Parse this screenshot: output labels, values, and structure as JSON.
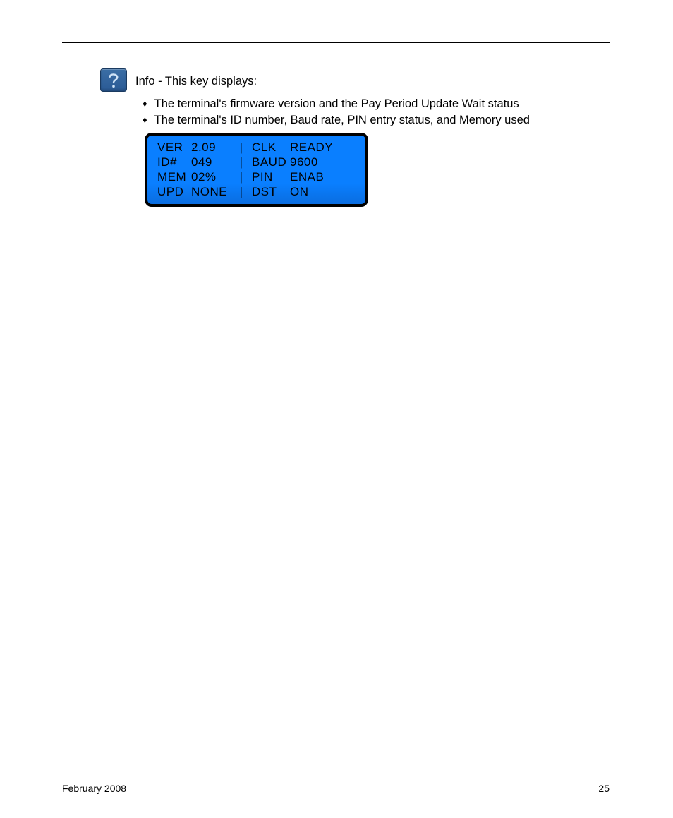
{
  "header": {
    "info_text": "Info - This key displays:"
  },
  "bullets": {
    "b1": "The terminal's firmware version and the Pay Period Update Wait status",
    "b2": "The terminal's ID number, Baud rate, PIN entry status, and Memory used"
  },
  "lcd": {
    "rows": [
      {
        "l1": "VER",
        "l2": "2.09",
        "sep": "|",
        "r1": "CLK",
        "r2": "READY"
      },
      {
        "l1": "ID#",
        "l2": "049",
        "sep": "|",
        "r1": "BAUD",
        "r2": "9600"
      },
      {
        "l1": "MEM",
        "l2": "02%",
        "sep": "|",
        "r1": "PIN",
        "r2": "ENAB"
      },
      {
        "l1": "UPD",
        "l2": "NONE",
        "sep": "|",
        "r1": "DST",
        "r2": "ON"
      }
    ]
  },
  "footer": {
    "left": "February  2008",
    "right": "25"
  }
}
